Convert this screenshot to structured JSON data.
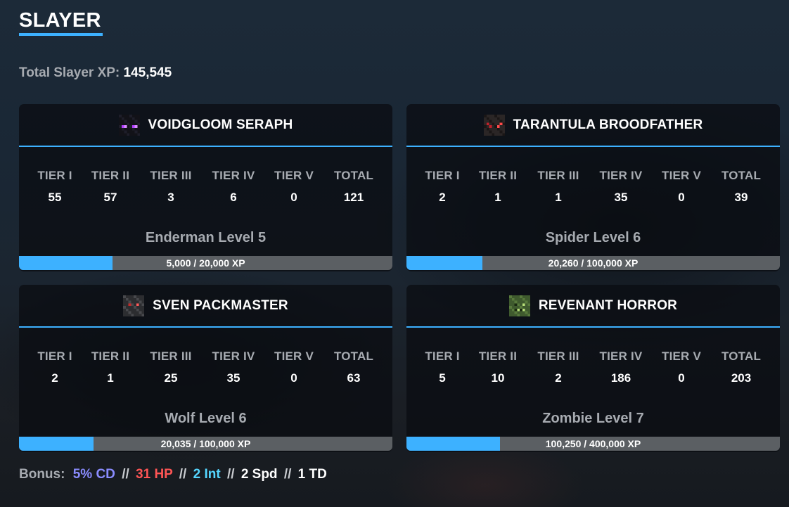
{
  "page": {
    "title": "SLAYER",
    "total_label": "Total Slayer XP:",
    "total_value": "145,545"
  },
  "slayers": [
    {
      "name": "VOIDGLOOM SERAPH",
      "icon": "enderman-head-icon",
      "tier_labels": [
        "TIER I",
        "TIER II",
        "TIER III",
        "TIER IV",
        "TIER V",
        "TOTAL"
      ],
      "tier_values": [
        "55",
        "57",
        "3",
        "6",
        "0",
        "121"
      ],
      "level": "Enderman Level 5",
      "progress_text": "5,000 / 20,000 XP",
      "progress": 0.25
    },
    {
      "name": "TARANTULA BROODFATHER",
      "icon": "spider-head-icon",
      "tier_labels": [
        "TIER I",
        "TIER II",
        "TIER III",
        "TIER IV",
        "TIER V",
        "TOTAL"
      ],
      "tier_values": [
        "2",
        "1",
        "1",
        "35",
        "0",
        "39"
      ],
      "level": "Spider Level 6",
      "progress_text": "20,260 / 100,000 XP",
      "progress": 0.2026
    },
    {
      "name": "SVEN PACKMASTER",
      "icon": "wolf-head-icon",
      "tier_labels": [
        "TIER I",
        "TIER II",
        "TIER III",
        "TIER IV",
        "TIER V",
        "TOTAL"
      ],
      "tier_values": [
        "2",
        "1",
        "25",
        "35",
        "0",
        "63"
      ],
      "level": "Wolf Level 6",
      "progress_text": "20,035 / 100,000 XP",
      "progress": 0.20035
    },
    {
      "name": "REVENANT HORROR",
      "icon": "zombie-head-icon",
      "tier_labels": [
        "TIER I",
        "TIER II",
        "TIER III",
        "TIER IV",
        "TIER V",
        "TOTAL"
      ],
      "tier_values": [
        "5",
        "10",
        "2",
        "186",
        "0",
        "203"
      ],
      "level": "Zombie Level 7",
      "progress_text": "100,250 / 400,000 XP",
      "progress": 0.250625
    }
  ],
  "bonus": {
    "label": "Bonus:",
    "separator": "//",
    "cd": "5% CD",
    "hp": "31 HP",
    "int": "2 Int",
    "spd": "2 Spd",
    "td": "1 TD"
  },
  "colors": {
    "accent": "#3db1ff",
    "muted_text": "#a7abb1",
    "bar_track": "#5b5f63",
    "cd": "#8a8cff",
    "hp": "#ff5555",
    "int": "#55d6ff"
  }
}
